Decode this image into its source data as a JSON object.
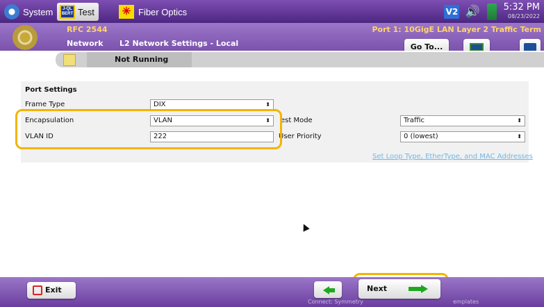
{
  "topbar": {
    "system_label": "System",
    "test_label": "Test",
    "test_icon_text": "J-QL BERT",
    "fiber_label": "Fiber Optics",
    "v2_label": "V2",
    "time": "5:32 PM",
    "date": "08/23/2022",
    "icons": [
      "gear-icon",
      "bert-icon",
      "fiber-optics-icon",
      "v2-icon",
      "speaker-icon",
      "battery-icon"
    ]
  },
  "header": {
    "app_name": "RFC 2544",
    "port_info": "Port 1: 10GigE LAN Layer 2 Traffic Term",
    "nav_section": "Network",
    "page_title": "L2 Network Settings - Local",
    "goto_label": "Go To..."
  },
  "status": {
    "run_state": "Not Running"
  },
  "port_settings": {
    "title": "Port Settings",
    "frame_type": {
      "label": "Frame Type",
      "value": "DIX"
    },
    "encapsulation": {
      "label": "Encapsulation",
      "value": "VLAN"
    },
    "vlan_id": {
      "label": "VLAN ID",
      "value": "222"
    },
    "test_mode": {
      "label": "est Mode",
      "value": "Traffic"
    },
    "user_priority": {
      "label": "User Priority",
      "value": "0 (lowest)"
    },
    "link": "Set Loop Type, EtherType, and MAC Addresses"
  },
  "footer": {
    "exit_label": "Exit",
    "next_label": "Next",
    "hint_back": "Connect: Symmetry",
    "hint_next": "emplates"
  },
  "colors": {
    "purple_bar": "#7b52ad",
    "header_gold": "#ffd46b",
    "highlight": "#f4b400",
    "link_blue": "#6fb7e6",
    "arrow_green": "#1fa81f"
  }
}
